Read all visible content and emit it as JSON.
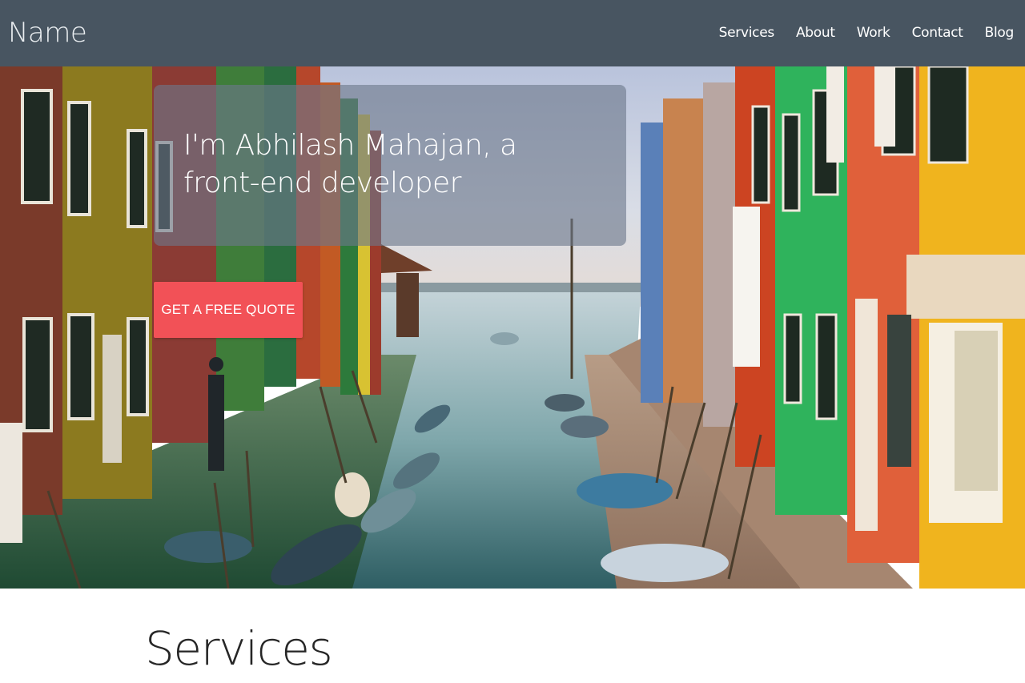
{
  "navbar": {
    "brand": "Name",
    "links": [
      {
        "label": "Services"
      },
      {
        "label": "About"
      },
      {
        "label": "Work"
      },
      {
        "label": "Contact"
      },
      {
        "label": "Blog"
      }
    ],
    "background": "#485561"
  },
  "hero": {
    "title": "I'm Abhilash Mahajan, a front-end developer",
    "cta_label": "GET A FREE QUOTE",
    "cta_color": "#f25157"
  },
  "services": {
    "title": "Services"
  }
}
